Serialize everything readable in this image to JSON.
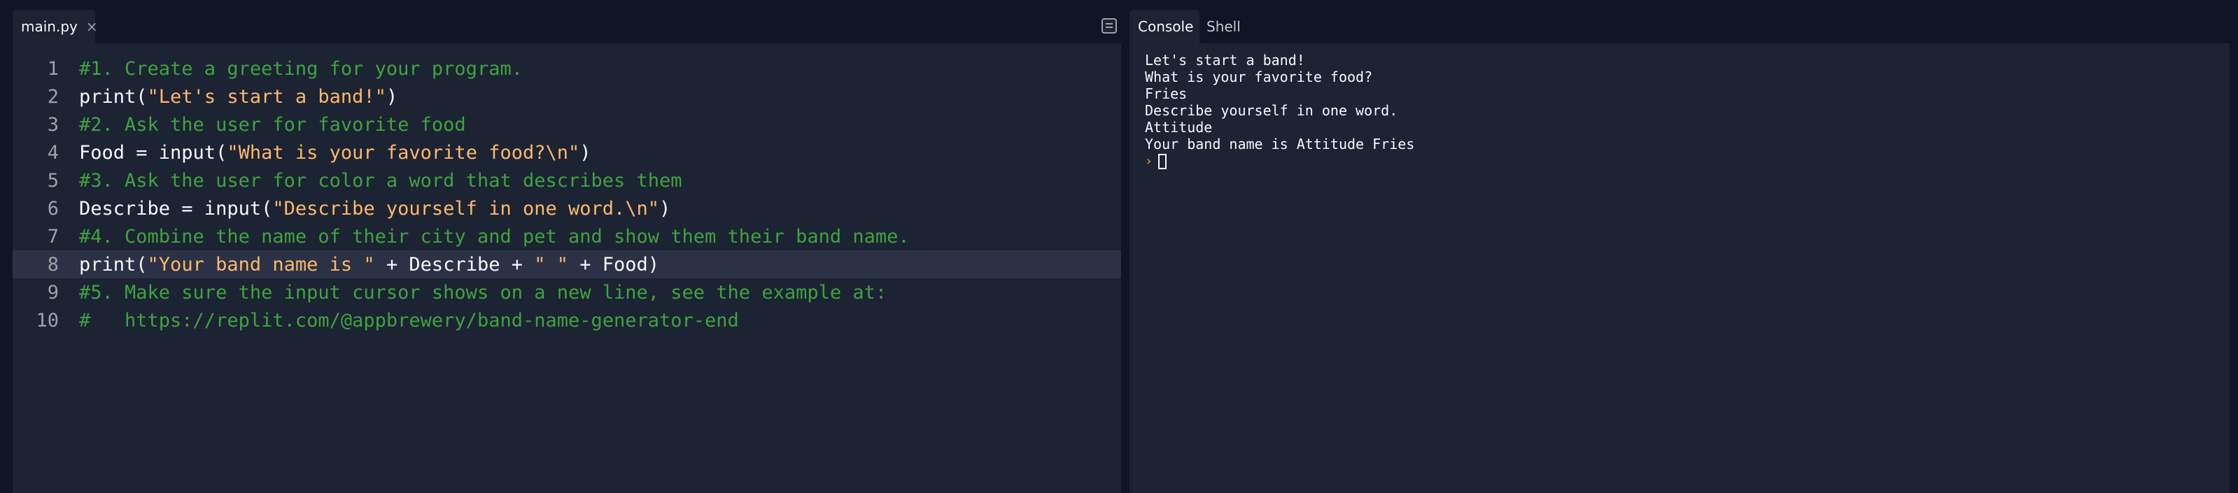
{
  "editor": {
    "tab_label": "main.py",
    "close_glyph": "×",
    "layout_icon": "layout-icon",
    "lines": [
      {
        "num": "1",
        "segments": [
          {
            "t": "#1. Create a greeting for your program.",
            "c": "cm"
          }
        ]
      },
      {
        "num": "2",
        "segments": [
          {
            "t": "print(",
            "c": "fn"
          },
          {
            "t": "\"Let's start a band!\"",
            "c": "st"
          },
          {
            "t": ")",
            "c": "fn"
          }
        ]
      },
      {
        "num": "3",
        "segments": [
          {
            "t": "#2. Ask the user for favorite food",
            "c": "cm"
          }
        ]
      },
      {
        "num": "4",
        "segments": [
          {
            "t": "Food = input(",
            "c": "fn"
          },
          {
            "t": "\"What is your favorite food?\\n\"",
            "c": "st"
          },
          {
            "t": ")",
            "c": "fn"
          }
        ]
      },
      {
        "num": "5",
        "segments": [
          {
            "t": "#3. Ask the user for color a word that describes them",
            "c": "cm"
          }
        ]
      },
      {
        "num": "6",
        "segments": [
          {
            "t": "Describe = input(",
            "c": "fn"
          },
          {
            "t": "\"Describe yourself in one word.\\n\"",
            "c": "st"
          },
          {
            "t": ")",
            "c": "fn"
          }
        ]
      },
      {
        "num": "7",
        "segments": [
          {
            "t": "#4. Combine the name of their city and pet and show them their band name.",
            "c": "cm"
          }
        ]
      },
      {
        "num": "8",
        "active": true,
        "segments": [
          {
            "t": "print(",
            "c": "fn"
          },
          {
            "t": "\"Your band name is \"",
            "c": "st"
          },
          {
            "t": " + Describe + ",
            "c": "fn"
          },
          {
            "t": "\" \"",
            "c": "st"
          },
          {
            "t": " + Food)",
            "c": "fn"
          }
        ]
      },
      {
        "num": "9",
        "segments": [
          {
            "t": "#5. Make sure the input cursor shows on a new line, see the example at:",
            "c": "cm"
          }
        ]
      },
      {
        "num": "10",
        "segments": [
          {
            "t": "#   https://replit.com/@appbrewery/band-name-generator-end",
            "c": "cm"
          }
        ]
      }
    ]
  },
  "console": {
    "tabs": [
      "Console",
      "Shell"
    ],
    "output": [
      "Let's start a band!",
      "What is your favorite food?",
      "Fries",
      "Describe yourself in one word.",
      "Attitude",
      "Your band name is Attitude Fries"
    ],
    "prompt_glyph": "›"
  },
  "colors": {
    "background": "#0e1525",
    "panel": "#1c2333",
    "active_line": "#2b3245",
    "comment": "#3fa33f",
    "string": "#ffb86b",
    "text": "#f5f9fc"
  }
}
